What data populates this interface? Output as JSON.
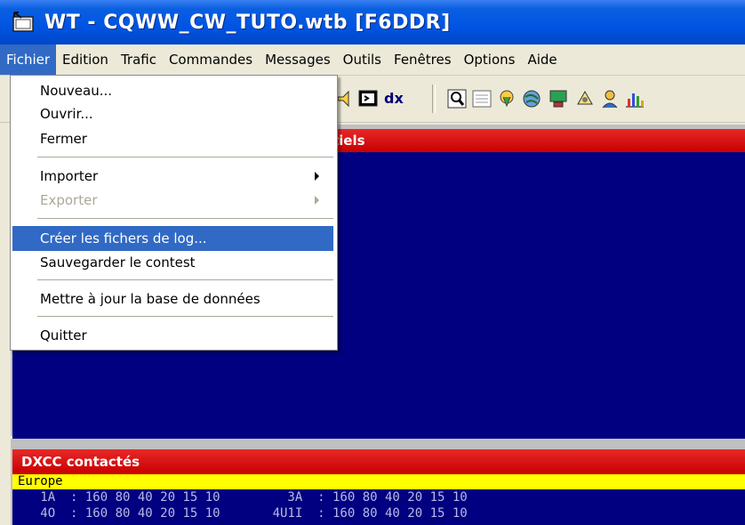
{
  "window": {
    "title": "WT - CQWW_CW_TUTO.wtb [F6DDR]"
  },
  "menubar": {
    "items": [
      "Fichier",
      "Edition",
      "Trafic",
      "Commandes",
      "Messages",
      "Outils",
      "Fenêtres",
      "Options",
      "Aide"
    ]
  },
  "toolbar": {
    "dx_label": "dx",
    "icons": [
      "speaker-icon",
      "terminal-icon",
      "dx-icon",
      "magnifier-icon",
      "list-icon",
      "map-pin-icon",
      "globe-icon",
      "computer-icon",
      "rotator-icon",
      "person-icon",
      "bar-chart-icon"
    ]
  },
  "fichier_menu": {
    "items": [
      {
        "label": "Nouveau...",
        "enabled": true
      },
      {
        "label": "Ouvrir...",
        "enabled": true
      },
      {
        "label": "Fermer",
        "enabled": true
      },
      {
        "label": "Importer",
        "enabled": true,
        "submenu": true
      },
      {
        "label": "Exporter",
        "enabled": false,
        "submenu": true
      },
      {
        "label": "Créer les fichers de log...",
        "enabled": true,
        "highlighted": true
      },
      {
        "label": "Sauvegarder le contest",
        "enabled": true
      },
      {
        "label": "Mettre à jour la base de données",
        "enabled": true
      },
      {
        "label": "Quitter",
        "enabled": true
      }
    ]
  },
  "panels": {
    "top_header_fragment": "tiels",
    "dxcc": {
      "title": "DXCC contactés",
      "region": "Europe",
      "rows": [
        "   1A  : 160 80 40 20 15 10         3A  : 160 80 40 20 15 10",
        "   4O  : 160 80 40 20 15 10       4U1I  : 160 80 40 20 15 10"
      ]
    }
  },
  "colors": {
    "titlebar": "#0054e3",
    "menu_highlight": "#316ac5",
    "panel_header": "#d00000",
    "panel_body": "#000080",
    "europe_band": "#ffff00"
  }
}
